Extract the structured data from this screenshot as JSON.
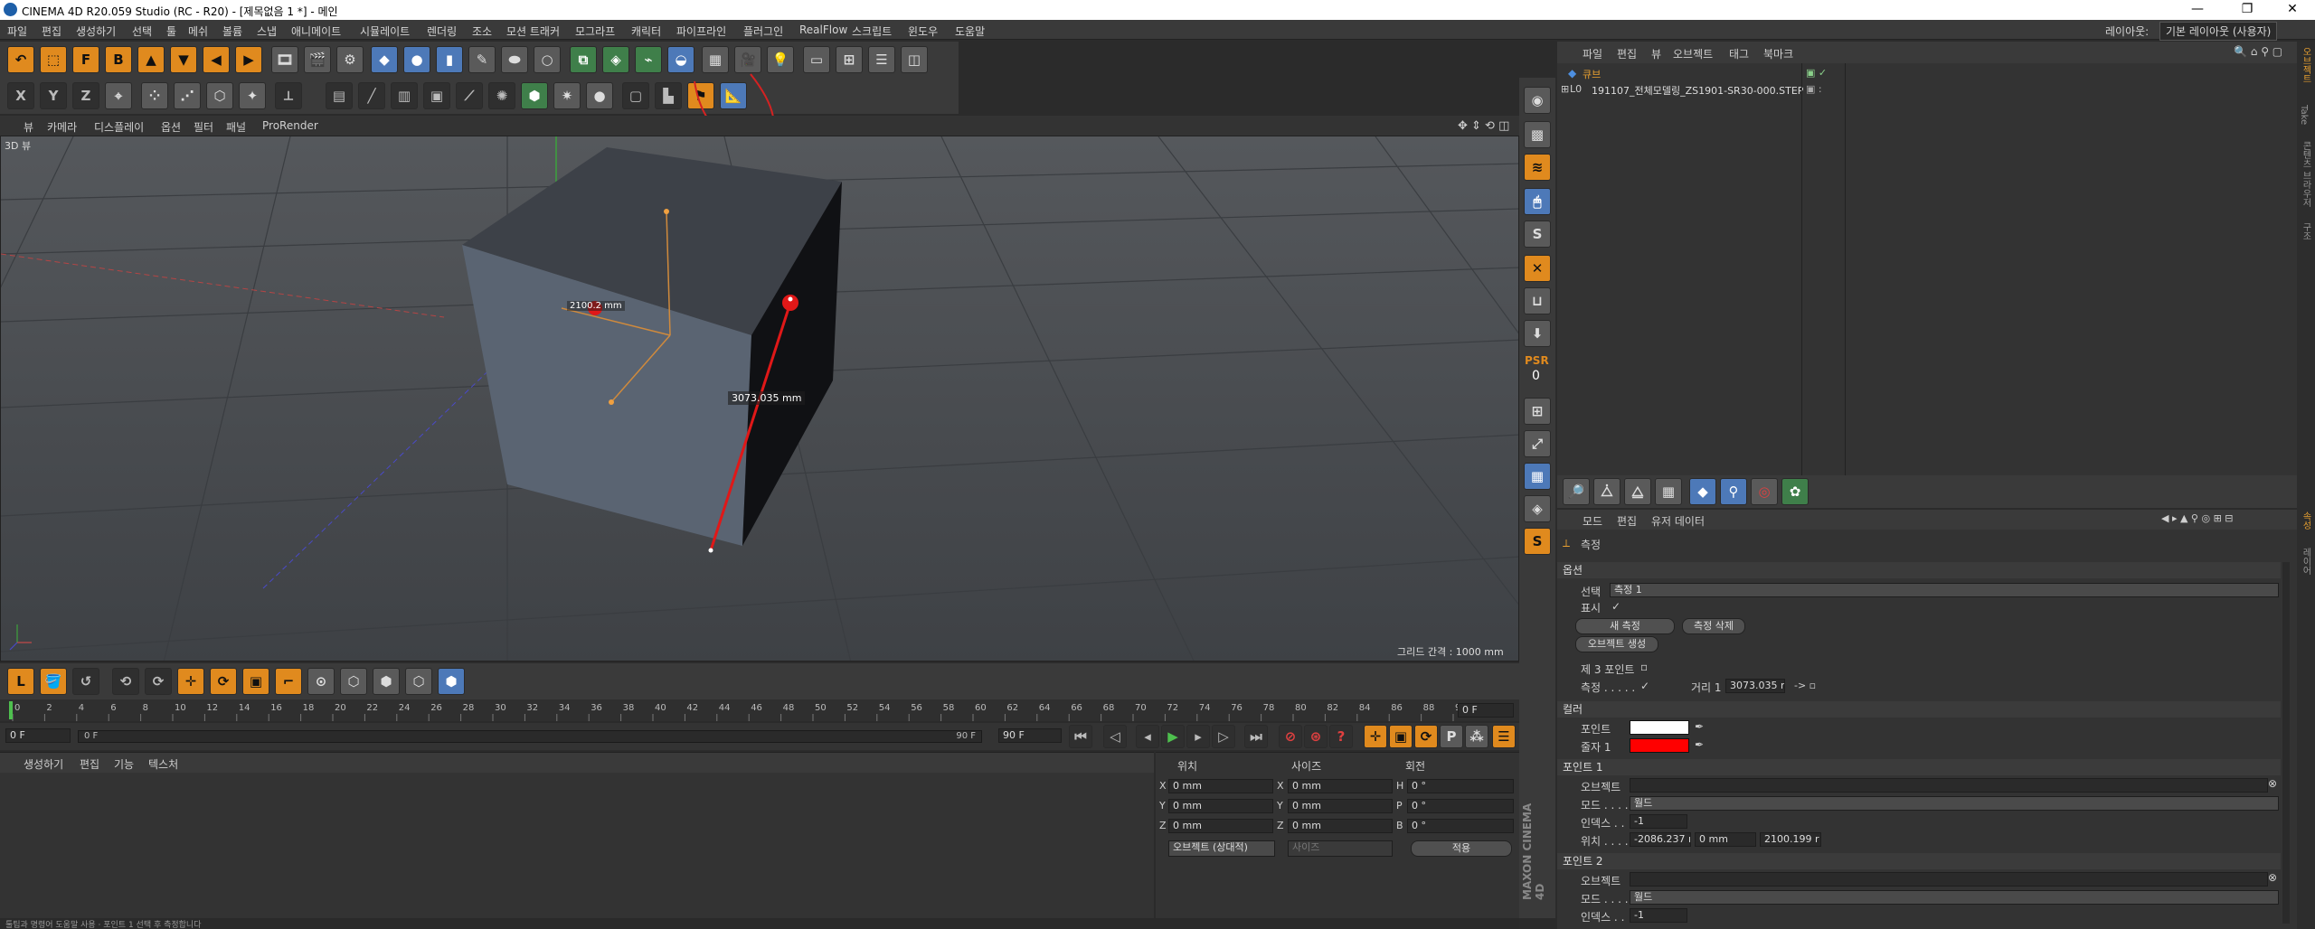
{
  "window": {
    "title": "CINEMA 4D R20.059 Studio (RC - R20) - [제목없음 1 *] - 메인",
    "minimize": "—",
    "restore": "❐",
    "close": "✕"
  },
  "menu": [
    "파일",
    "편집",
    "생성하기",
    "선택",
    "툴",
    "메쉬",
    "볼륨",
    "스냅",
    "애니메이트",
    "시뮬레이트",
    "렌더링",
    "조소",
    "모션 트래커",
    "모그라프",
    "캐릭터",
    "파이프라인",
    "플러그인",
    "RealFlow",
    "스크립트",
    "윈도우",
    "도움말"
  ],
  "layout": {
    "label": "레이아웃:",
    "value": "기본 레이아웃 (사용자)"
  },
  "viewport": {
    "menu": [
      "뷰",
      "카메라",
      "디스플레이",
      "옵션",
      "필터",
      "패널",
      "ProRender"
    ],
    "label": "3D 뷰",
    "grid_label": "그리드 간격 : 1000 mm",
    "measure_label": "3073.035 mm",
    "small_label": "2100.2 mm"
  },
  "timeline": {
    "ticks": [
      "0",
      "2",
      "4",
      "6",
      "8",
      "10",
      "12",
      "14",
      "16",
      "18",
      "20",
      "22",
      "24",
      "26",
      "28",
      "30",
      "32",
      "34",
      "36",
      "38",
      "40",
      "42",
      "44",
      "46",
      "48",
      "50",
      "52",
      "54",
      "56",
      "58",
      "60",
      "62",
      "64",
      "66",
      "68",
      "70",
      "72",
      "74",
      "76",
      "78",
      "80",
      "82",
      "84",
      "86",
      "88",
      "90"
    ],
    "end_frame": "0 F",
    "start_field": "0 F",
    "slider_start": "0 F",
    "slider_end": "90 F",
    "end_field": "90 F"
  },
  "material": {
    "menu": [
      "생성하기",
      "편집",
      "기능",
      "텍스처"
    ]
  },
  "coords": {
    "headers": [
      "위치",
      "사이즈",
      "회전"
    ],
    "rows": [
      {
        "a": "X",
        "v1": "0 mm",
        "b": "X",
        "v2": "0 mm",
        "c": "H",
        "v3": "0 °"
      },
      {
        "a": "Y",
        "v1": "0 mm",
        "b": "Y",
        "v2": "0 mm",
        "c": "P",
        "v3": "0 °"
      },
      {
        "a": "Z",
        "v1": "0 mm",
        "b": "Z",
        "v2": "0 mm",
        "c": "B",
        "v3": "0 °"
      }
    ],
    "mode": "오브젝트 (상대적)",
    "size_mode": "사이즈",
    "apply": "적용"
  },
  "objects": {
    "menu": [
      "파일",
      "편집",
      "뷰",
      "오브젝트",
      "태그",
      "북마크"
    ],
    "items": [
      "큐브",
      "191107_전체모델링_ZS1901-SR30-000.STEP"
    ]
  },
  "attributes": {
    "menu": [
      "모드",
      "편집",
      "유저 데이터"
    ],
    "tool_title": "측정",
    "options_title": "옵션",
    "select_label": "선택",
    "select_value": "측정 1",
    "display_label": "표시",
    "new_measure": "새 측정",
    "delete_measure": "측정 삭제",
    "create_object": "오브젝트 생성",
    "third_point_label": "제 3 포인트",
    "measure_label": "측정 . . . . .",
    "distance_label": "거리 1",
    "distance_value": "3073.035 r",
    "color_title": "컬러",
    "point_label": "포인트",
    "line1_label": "줄자 1",
    "point1_title": "포인트 1",
    "object_label": "오브젝트",
    "mode_label": "모드 . . . . .",
    "mode_value": "월드",
    "index_label": "인덱스 . .",
    "index_value": "-1",
    "pos_label": "위치 . . . . .",
    "pos_x": "-2086.237 r",
    "pos_y": "0 mm",
    "pos_z": "2100.199 r",
    "point2_title": "포인트 2",
    "object2_label": "오브젝트",
    "mode2_label": "모드 . . . . .",
    "mode2_value": "월드",
    "index2_label": "인덱스 . .",
    "index2_value": "-1"
  },
  "status": {
    "text": "툴팁과 명령어 도움말 사용 · 포인트 1 선택 후 측정합니다",
    "psr": "PSR",
    "psr_value": "0"
  },
  "side_tabs": [
    "오브젝트",
    "Take",
    "콘텐츠 브라우저",
    "구조"
  ],
  "side_tabs2": [
    "속성",
    "레이어"
  ],
  "maxon": "MAXON CINEMA 4D"
}
